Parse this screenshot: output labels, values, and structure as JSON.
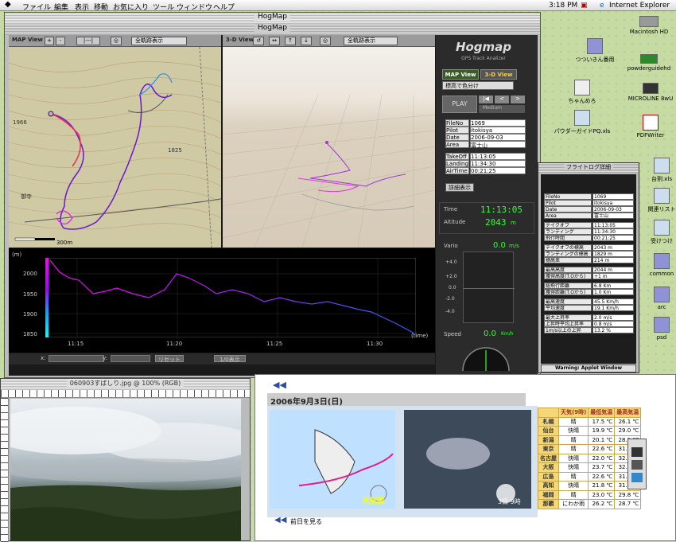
{
  "menubar": {
    "apple": "",
    "items": [
      "ファイル",
      "編集",
      "表示",
      "移動",
      "お気に入り",
      "ツール",
      "ウィンドウ",
      "ヘルプ"
    ],
    "clock": "3:18 PM",
    "app": "Internet Explorer"
  },
  "desktop": {
    "icons": [
      "Macintosh HD",
      "powderguidehd",
      "つついきん番用",
      "ちゃんめろ",
      "MICROLINE 8wU",
      "パウダーガイドPQ.xls",
      "PDFWriter",
      "台割.xls",
      "関連リスト",
      "受けつけ",
      "common",
      "arc",
      "psd"
    ]
  },
  "hogmap": {
    "title": "HogMap",
    "subtitle": "HogMap",
    "map_view_label": "MAP View",
    "view3d_label": "3-D View",
    "display_all": "全軌跡表示",
    "display_all_3d": "全軌跡表示",
    "scale": "300m",
    "logo": "Hogmap",
    "logo_sub": "GPS Track Analizer",
    "btn_map": "MAP View",
    "btn_3d": "3-D View",
    "color_select": "標高で色分け",
    "play": "PLAY",
    "speed": "Medium",
    "info": [
      {
        "k": "FileNo",
        "v": "1069"
      },
      {
        "k": "Pilot",
        "v": "itokisya"
      },
      {
        "k": "Date",
        "v": "2006-09-03"
      },
      {
        "k": "Area",
        "v": "富士山"
      }
    ],
    "times": [
      {
        "k": "TakeOff",
        "v": "11:13:05"
      },
      {
        "k": "Landing",
        "v": "11:34:30"
      },
      {
        "k": "AirTime",
        "v": "00:21:25"
      }
    ],
    "detail_btn": "詳細表示",
    "time_label": "Time",
    "time_val": "11:13:05",
    "alt_label": "Altitude",
    "alt_val": "2043",
    "alt_unit": "m",
    "vario_label": "Vario",
    "vario_val": "0.0",
    "vario_unit": "m/s",
    "vario_ticks": [
      "+4.0",
      "+2.0",
      "0.0",
      "-2.0",
      "-4.0"
    ],
    "speed_label": "Speed",
    "speed_val": "0.0",
    "speed_unit": "Km/h",
    "graph_unit": "(m)",
    "graph_yticks": [
      "2000",
      "1950",
      "1900",
      "1850"
    ],
    "graph_xticks": [
      "11:15",
      "11:20",
      "11:25",
      "11:30"
    ],
    "graph_xlabel": "(time)",
    "ctrl": {
      "x": "x:",
      "y": "y:",
      "reset": "リセット",
      "export": "1/0表示"
    }
  },
  "flightlog": {
    "title": "フライトログ詳細",
    "rows": [
      {
        "k": "FileNo",
        "v": "1069"
      },
      {
        "k": "Pilot",
        "v": "itokisya"
      },
      {
        "k": "Date",
        "v": "2006-09-03"
      },
      {
        "k": "Area",
        "v": "富士山"
      },
      {
        "k": "テイクオフ",
        "v": "11:13:05"
      },
      {
        "k": "ランディング",
        "v": "11:34:30"
      },
      {
        "k": "飛行時間",
        "v": "00:21:25"
      },
      {
        "k": "テイクオフの標高",
        "v": "2043 m"
      },
      {
        "k": "ランディングの標高",
        "v": "1829 m"
      },
      {
        "k": "標高差",
        "v": "214 m"
      },
      {
        "k": "最高高度",
        "v": "2044 m"
      },
      {
        "k": "獲得高度(T.Oから)",
        "v": "+1 m"
      },
      {
        "k": "総飛行距離",
        "v": "6.8 Km"
      },
      {
        "k": "獲得距離(T.Oから)",
        "v": "1.0 Km"
      },
      {
        "k": "最高速度",
        "v": "45.5 Km/h"
      },
      {
        "k": "平均速度",
        "v": "19.1 Km/h"
      },
      {
        "k": "最大上昇率",
        "v": "2.0 m/s"
      },
      {
        "k": "上昇時平均上昇率",
        "v": "0.8 m/s"
      },
      {
        "k": "1m/s以上の上昇",
        "v": "13.2 %"
      }
    ],
    "warning": "Warning: Applet Window"
  },
  "photo": {
    "title": "060903すばしり.jpg @ 100% (RGB)"
  },
  "weather": {
    "date": "2006年9月3日(日)",
    "map_caption": "天気図",
    "sat_caption": "3日 9時",
    "prev": "前日を見る",
    "headers": [
      "",
      "天気(9時)",
      "最低気温",
      "最高気温"
    ],
    "rows": [
      [
        "札幌",
        "晴",
        "17.5 ℃",
        "26.1 ℃"
      ],
      [
        "仙台",
        "快晴",
        "19.9 ℃",
        "29.0 ℃"
      ],
      [
        "新潟",
        "晴",
        "20.1 ℃",
        "28.1 ℃"
      ],
      [
        "東京",
        "晴",
        "22.6 ℃",
        "31.2 ℃"
      ],
      [
        "名古屋",
        "快晴",
        "22.0 ℃",
        "32.0 ℃"
      ],
      [
        "大阪",
        "快晴",
        "23.7 ℃",
        "32.7 ℃"
      ],
      [
        "広島",
        "晴",
        "22.6 ℃",
        "31.2 ℃"
      ],
      [
        "高知",
        "快晴",
        "21.8 ℃",
        "31.7 ℃"
      ],
      [
        "福岡",
        "晴",
        "23.0 ℃",
        "29.8 ℃"
      ],
      [
        "那覇",
        "にわか雨",
        "26.2 ℃",
        "28.7 ℃"
      ]
    ]
  }
}
